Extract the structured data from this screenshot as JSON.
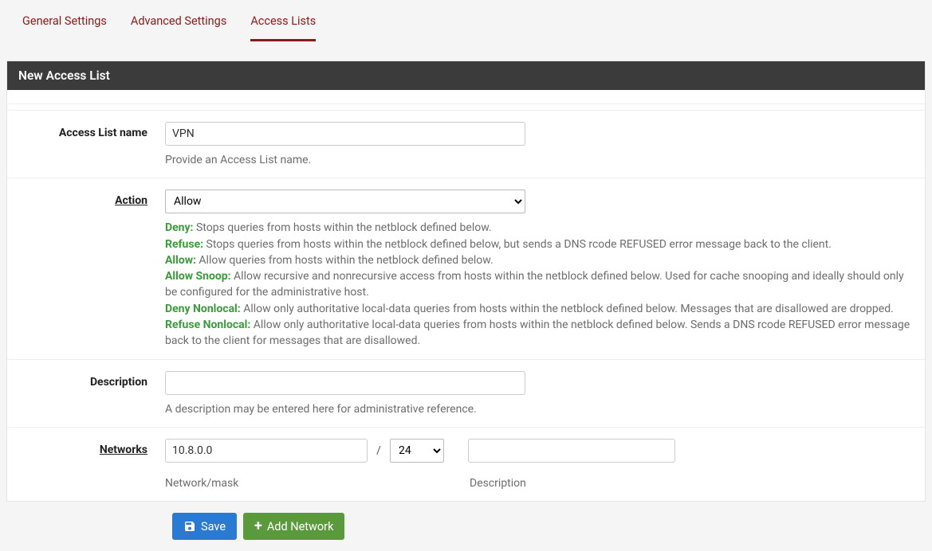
{
  "tabs": {
    "general": "General Settings",
    "advanced": "Advanced Settings",
    "access": "Access Lists"
  },
  "panel": {
    "title": "New Access List"
  },
  "fields": {
    "name": {
      "label": "Access List name",
      "value": "VPN",
      "help": "Provide an Access List name."
    },
    "action": {
      "label": "Action",
      "value": "Allow",
      "options": [
        "Deny",
        "Refuse",
        "Allow",
        "Allow Snoop",
        "Deny Nonlocal",
        "Refuse Nonlocal"
      ],
      "desc": {
        "deny_t": "Deny:",
        "deny": " Stops queries from hosts within the netblock defined below.",
        "refuse_t": "Refuse:",
        "refuse": " Stops queries from hosts within the netblock defined below, but sends a DNS rcode REFUSED error message back to the client.",
        "allow_t": "Allow:",
        "allow": " Allow queries from hosts within the netblock defined below.",
        "snoop_t": "Allow Snoop:",
        "snoop": " Allow recursive and nonrecursive access from hosts within the netblock defined below. Used for cache snooping and ideally should only be configured for the administrative host.",
        "denynl_t": "Deny Nonlocal:",
        "denynl": " Allow only authoritative local-data queries from hosts within the netblock defined below. Messages that are disallowed are dropped.",
        "refusenl_t": "Refuse Nonlocal:",
        "refusenl": " Allow only authoritative local-data queries from hosts within the netblock defined below. Sends a DNS rcode REFUSED error message back to the client for messages that are disallowed."
      }
    },
    "description": {
      "label": "Description",
      "value": "",
      "help": "A description may be entered here for administrative reference."
    },
    "networks": {
      "label": "Networks",
      "network_value": "10.8.0.0",
      "mask_value": "24",
      "row_desc_value": "",
      "help_net": "Network/mask",
      "help_desc": "Description"
    }
  },
  "buttons": {
    "save": "Save",
    "add_network": "Add Network"
  }
}
